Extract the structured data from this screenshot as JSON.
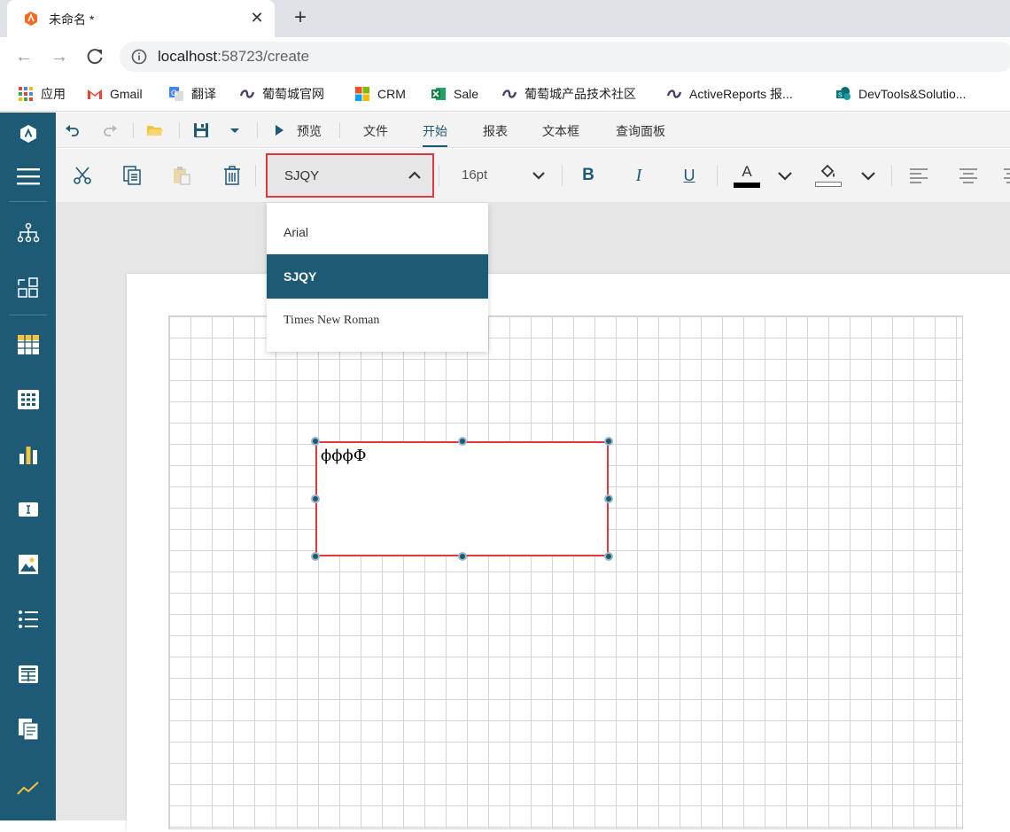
{
  "browser": {
    "tab_title": "未命名 *",
    "url_host": "localhost",
    "url_rest": ":58723/create",
    "bookmarks": [
      {
        "label": "应用",
        "icon": "apps-grid-icon"
      },
      {
        "label": "Gmail",
        "icon": "gmail-icon"
      },
      {
        "label": "翻译",
        "icon": "translate-icon"
      },
      {
        "label": "葡萄城官网",
        "icon": "grapecity-icon"
      },
      {
        "label": "CRM",
        "icon": "microsoft-icon"
      },
      {
        "label": "Sale",
        "icon": "excel-icon"
      },
      {
        "label": "葡萄城产品技术社区",
        "icon": "grapecity-icon"
      },
      {
        "label": "ActiveReports 报...",
        "icon": "grapecity-icon"
      },
      {
        "label": "DevTools&Solutio...",
        "icon": "sharepoint-icon"
      }
    ]
  },
  "menubar": {
    "preview": "预览",
    "tabs": [
      "文件",
      "开始",
      "报表",
      "文本框",
      "查询面板"
    ],
    "active_tab": "开始"
  },
  "toolbar": {
    "font_family": "SJQY",
    "font_size": "16pt",
    "bold": "B",
    "italic": "I",
    "underline": "U",
    "font_color_letter": "A"
  },
  "font_dropdown": {
    "options": [
      "Arial",
      "SJQY",
      "Times New Roman"
    ],
    "selected": "SJQY"
  },
  "textbox": {
    "content": "ϕϕϕΦ"
  },
  "colors": {
    "accent": "#1d5a75",
    "highlight_border": "#e0393c"
  }
}
